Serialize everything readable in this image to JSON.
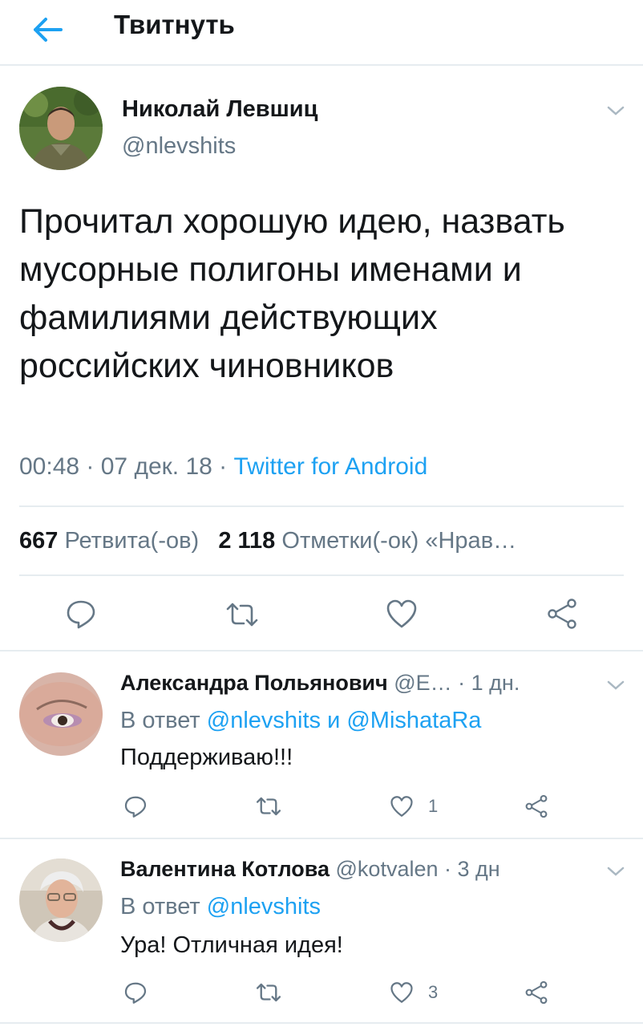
{
  "header": {
    "title": "Твитнуть",
    "back_icon": "arrow-left-icon"
  },
  "tweet": {
    "author_name": "Николай Левшиц",
    "author_handle": "@nlevshits",
    "text": "Прочитал хорошую идею, назвать мусорные полигоны именами и фамилиями действующих российских чиновников",
    "time": "00:48",
    "sep1": " · ",
    "date": "07 дек. 18",
    "sep2": " · ",
    "source": "Twitter for Android",
    "retweets_count": "667",
    "retweets_label": "Ретвита(-ов)",
    "likes_count": "2 118",
    "likes_label": "Отметки(-ок)",
    "likes_more": "«Нрав…"
  },
  "replies": [
    {
      "name": "Александра Польянович",
      "handle_time": "@E… · 1 дн.",
      "reply_prefix": "В ответ",
      "reply_mentions": "@nlevshits и @MishataRa",
      "text": "Поддерживаю!!!",
      "like_count": "1"
    },
    {
      "name": "Валентина Котлова",
      "handle_time": "@kotvalen · 3 дн",
      "reply_prefix": "В ответ",
      "reply_mentions": "@nlevshits",
      "text": "Ура! Отличная идея!",
      "like_count": "3"
    }
  ],
  "colors": {
    "accent": "#1da1f2",
    "secondary_text": "#657786",
    "divider": "#e6ecf0",
    "icon": "#657786"
  }
}
